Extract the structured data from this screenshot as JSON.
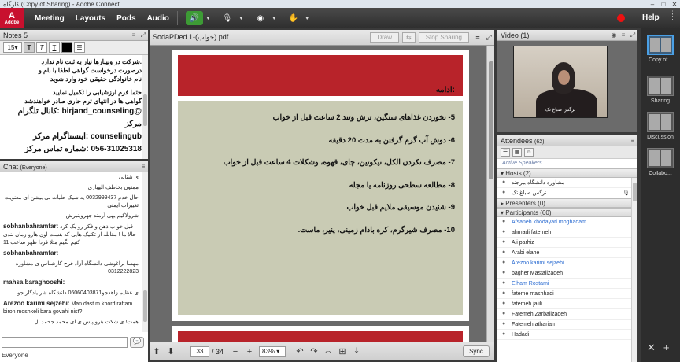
{
  "window": {
    "title": "کارگاه (Copy of Sharing) - Adobe Connect"
  },
  "menu": {
    "items": [
      "Meeting",
      "Layouts",
      "Pods",
      "Audio"
    ],
    "help": "Help",
    "logo": "Adobe"
  },
  "notes": {
    "title": "Notes 5",
    "font_size": "15",
    "lines": [
      ".شرکت در وبینارها نیاز به ثبت نام ندارد",
      "درصورت درخواست گواهی لطفا با نام و",
      "نام خانوادگی حقیقی خود وارد شوید",
      "حتما فرم ارزشیابی را تکمیل نمایید",
      "گواهی ها در انتهای ترم جاری صادر خواهندشد"
    ],
    "contacts": [
      "@birjand_counseling :کانال تلگرام مرکز",
      "counselingub :اینستاگرام مرکز",
      "056-31025318 :شماره تماس مرکز"
    ]
  },
  "chat": {
    "title": "Chat",
    "scope": "(Everyone)",
    "to": "Everyone",
    "messages": [
      {
        "name": "",
        "text": "ی شتابی",
        "rtl": true
      },
      {
        "name": "",
        "text": "ممنون بخاطف الهیاری",
        "rtl": true
      },
      {
        "name": "",
        "text": "حال خدم 0032999437 یه شیک حلبات بی بیشن ای معنویت تغییرات ایمنی",
        "rtl": true
      },
      {
        "name": "",
        "text": "شرولاکیم بهی آرمند جهروبنیرش",
        "rtl": true
      },
      {
        "name": "sobhanbahramfar:",
        "text": "قبل خواب ذهن و فکر رو یک کرد حالا ما ! مقابله از تکنیک هایی که هست اون هارو زمان بندی کنیم بگیم مثلا فردا ظهر ساعت 11",
        "rtl": false
      },
      {
        "name": "sobhanbahramfar:",
        "text": "،",
        "rtl": false
      },
      {
        "name": "",
        "text": "مهسا براغوشی دانشگاه آزاد فرح کارشناس ی مشاوره 0312222823",
        "rtl": true
      },
      {
        "name": "mahsa baraghooshi:",
        "text": "",
        "rtl": false
      },
      {
        "name": "",
        "text": "ی عظیم زاهدجو06060403871 دانشگاه شر یادگار جو",
        "rtl": true
      },
      {
        "name": "Arezoo karimi sejzehi:",
        "text": "Man dast m khord raftam biron moshkeli bara govahi nist?",
        "rtl": false
      },
      {
        "name": "",
        "text": "همت! ی شکت هرو پیش ی ای محمد جحمد ال",
        "rtl": true
      }
    ]
  },
  "doc": {
    "title": "SodaPDed.1-(خواب).pdf",
    "draw_label": "Draw",
    "stop_label": "Stop Sharing",
    "heading": "ادامه:",
    "items": [
      "5- نخوردن غذاهای سنگین، ترش وتند 2 ساعت قبل از خواب",
      "6- دوش آب گرم گرفتن به مدت 20 دقیقه",
      "7- مصرف نکردن الکل، نیکوتین، چای، قهوه، وشکلات 4 ساعت قبل از خواب",
      "8- مطالعه سطحی روزنامه یا مجله",
      "9- شنیدن موسیقی ملایم قبل خواب",
      "10- مصرف شیرگرم، کره بادام زمینی، پنیر، ماست."
    ],
    "page": "33",
    "total": "/ 34",
    "zoom": "83%",
    "sync_label": "Sync"
  },
  "video": {
    "title": "Video",
    "count": "(1)",
    "name": "نرگس صباغ تک"
  },
  "attendees": {
    "title": "Attendees",
    "count": "(62)",
    "active_speakers": "Active Speakers",
    "hosts_label": "Hosts (2)",
    "hosts": [
      "مشاوره دانشگاه بیرجند",
      "نرگس صباغ تک"
    ],
    "presenters_label": "Presenters (0)",
    "participants_label": "Participants (60)",
    "participants": [
      {
        "name": "Afsaneh khodayari moghadam",
        "blue": true
      },
      {
        "name": "ahmadi fatemeh",
        "blue": false
      },
      {
        "name": "Ali parhiz",
        "blue": false
      },
      {
        "name": "Arabi elahe",
        "blue": false
      },
      {
        "name": "Arezoo karimi sejzehi",
        "blue": true
      },
      {
        "name": "bagher Mastalizadeh",
        "blue": false
      },
      {
        "name": "Elham Rostami",
        "blue": true
      },
      {
        "name": "fateme mashhadi",
        "blue": false
      },
      {
        "name": "fatemeh jalili",
        "blue": false
      },
      {
        "name": "Fatemeh Zarbalizadeh",
        "blue": false
      },
      {
        "name": "Fatemeh.atharian",
        "blue": false
      },
      {
        "name": "Hadadi",
        "blue": false
      }
    ]
  },
  "sidebar": {
    "layouts": [
      "Copy of...",
      "Sharing",
      "Discussion",
      "Collabo..."
    ]
  }
}
